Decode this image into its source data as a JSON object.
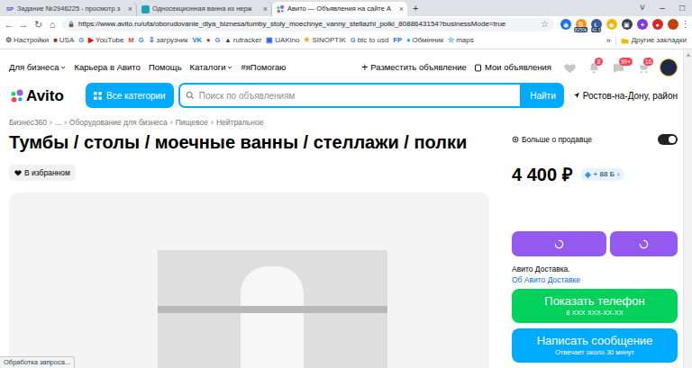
{
  "browser": {
    "tabs": [
      {
        "kind": "letters",
        "icon": "SP",
        "label": "Задание №2946225 - просмотр з",
        "close": "×",
        "selected": false
      },
      {
        "kind": "square",
        "color": "#1aa3b8",
        "label": "Односекционная ванна из нерж",
        "close": "×",
        "selected": false
      },
      {
        "kind": "avito",
        "label": "Авито — Объявления на сайте А",
        "close": "×",
        "selected": true
      }
    ],
    "new_tab": "+",
    "window_controls": [
      "˅",
      "–",
      "□"
    ],
    "nav": [
      "←",
      "→",
      "↻",
      "⌂"
    ],
    "url": "https://www.avito.ru/ufa/oborudovanie_dlya_biznesa/tumby_stoly_moechnye_vanny_stellazhi_polki_8088643154?businessMode=true",
    "field_icons": [
      "☆"
    ],
    "extensions": [
      {
        "text": "◉",
        "color": "#1a73e8",
        "badge": null
      },
      {
        "text": "₿",
        "color": "#f7931a",
        "badge": "8250k"
      },
      {
        "text": "Ł",
        "color": "#345d9d",
        "badge": "42.3"
      },
      {
        "text": "◆",
        "color": "#f0b90b",
        "badge": null
      },
      {
        "text": "▣",
        "color": "#374151",
        "badge": null
      },
      {
        "text": "✦",
        "color": "#7c3aed",
        "badge": null
      },
      {
        "text": "●",
        "color": "#dc2626",
        "badge": null
      }
    ],
    "menu": "⋮",
    "bookmarks": [
      {
        "icon": "⚙",
        "color": "#5f6368",
        "label": "Настройки"
      },
      {
        "icon": "■",
        "color": "#b91c1c",
        "label": "USA"
      },
      {
        "icon": "G",
        "color": "#4285f4"
      },
      {
        "icon": "▶",
        "color": "#ff0000",
        "label": "YouTube"
      },
      {
        "icon": "M",
        "color": "#ea4335"
      },
      {
        "icon": "G",
        "color": "#4285f4"
      },
      {
        "icon": "⇩",
        "color": "#2563eb",
        "label": "загрузчик"
      },
      {
        "icon": "VK",
        "color": "#0077ff"
      },
      {
        "icon": "●",
        "color": "#dc2626"
      },
      {
        "icon": "G",
        "color": "#4285f4"
      },
      {
        "icon": "▲",
        "color": "#374151",
        "label": "rutracker"
      },
      {
        "icon": "▣",
        "color": "#2563eb",
        "label": "UAKino"
      },
      {
        "icon": "☀",
        "color": "#f59e0b",
        "label": "SINOPTIK"
      },
      {
        "icon": "G",
        "color": "#4285f4",
        "label": "btc to usd"
      },
      {
        "icon": "FP",
        "color": "#2563eb"
      },
      {
        "icon": "●",
        "color": "#0ea5e9",
        "label": "Обмінник"
      },
      {
        "icon": "☆",
        "color": "#0ea5e9",
        "label": "maps"
      }
    ],
    "bookmarks_more": "»",
    "other_bookmarks": "Другие закладки"
  },
  "avito": {
    "top_links": [
      {
        "label": "Для бизнеса",
        "dropdown": true
      },
      {
        "label": "Карьера в Авито",
        "dropdown": false
      },
      {
        "label": "Помощь",
        "dropdown": false
      },
      {
        "label": "Каталоги",
        "dropdown": true
      },
      {
        "label": "#яПомогаю",
        "dropdown": false
      }
    ],
    "post_ad": {
      "icon": "+",
      "label": "Разместить объявление"
    },
    "my_ads": "Мои объявления",
    "header_icons": [
      {
        "kind": "heart",
        "badge": null
      },
      {
        "kind": "bell",
        "badge": "8"
      },
      {
        "kind": "chat",
        "badge": "99+"
      },
      {
        "kind": "cart",
        "badge": "16"
      }
    ],
    "logo": "Avito",
    "categories": "Все категории",
    "search_placeholder": "Поиск по объявлениям",
    "search_button": "Найти",
    "location": "Ростов-на-Дону, район"
  },
  "breadcrumbs": {
    "separator": "›",
    "items": [
      "Бизнес360",
      "...",
      "Оборудование для бизнеса",
      "Пищевое",
      "Нейтральное"
    ]
  },
  "listing": {
    "title": "Тумбы / столы / моечные ванны / стеллажи / полки",
    "favorite": {
      "label": "В избранном",
      "selected": true
    },
    "seller_toggle": {
      "label": "Больше о продавце",
      "on": true
    },
    "price": "4 400 ₽",
    "bonus": "+ 88 Б",
    "buy_buttons": [
      {
        "loading": true
      },
      {
        "loading": true
      }
    ],
    "delivery": {
      "text": "Авито Доставка.",
      "link": "Об Авито Доставке"
    },
    "phone": {
      "label": "Показать телефон",
      "sub": "8 XXX XXX-XX-XX"
    },
    "message": {
      "label": "Написать сообщение",
      "sub": "Отвечает около 30 минут"
    }
  },
  "status_bar": "Обработка запроса..."
}
